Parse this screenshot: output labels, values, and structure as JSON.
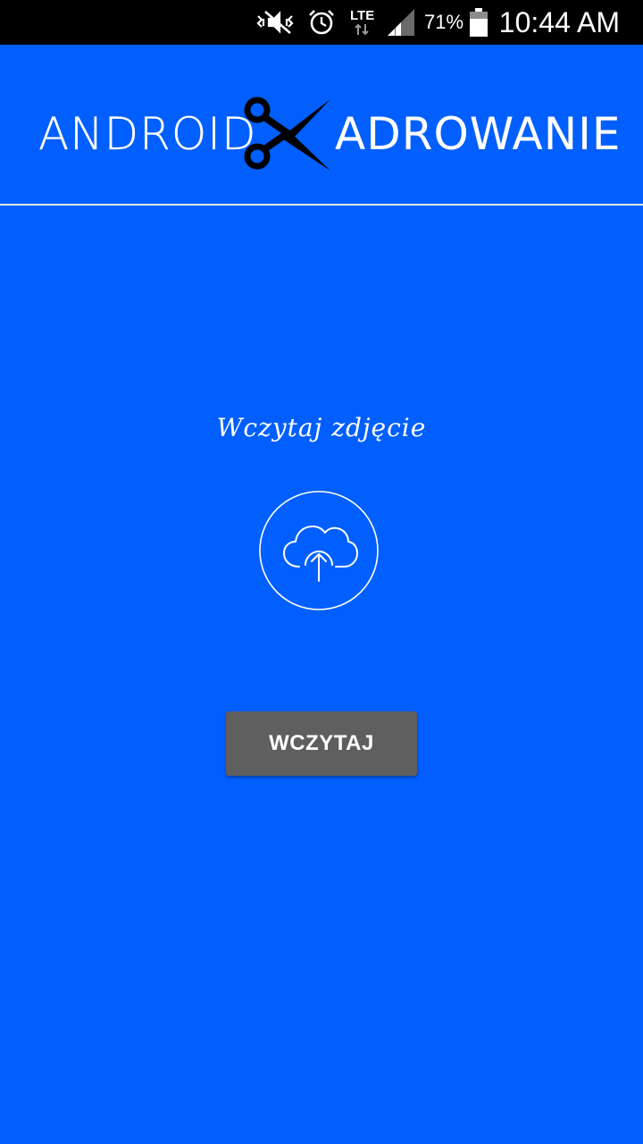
{
  "status_bar": {
    "icons": [
      "mute-vibrate-icon",
      "alarm-icon",
      "lte-icon",
      "signal-icon",
      "battery-icon"
    ],
    "lte_label": "LTE",
    "battery_percent": "71%",
    "time": "10:44 AM"
  },
  "header": {
    "logo_left": "ANDROID",
    "logo_icon": "scissors-icon",
    "logo_right": "ADROWANIE"
  },
  "main": {
    "title": "Wczytaj zdjęcie",
    "upload_icon": "cloud-upload-icon",
    "button_label": "WCZYTAJ"
  },
  "colors": {
    "background": "#005ffe",
    "status_bar": "#000000",
    "button": "#5f5f5f",
    "text": "#ffffff"
  }
}
